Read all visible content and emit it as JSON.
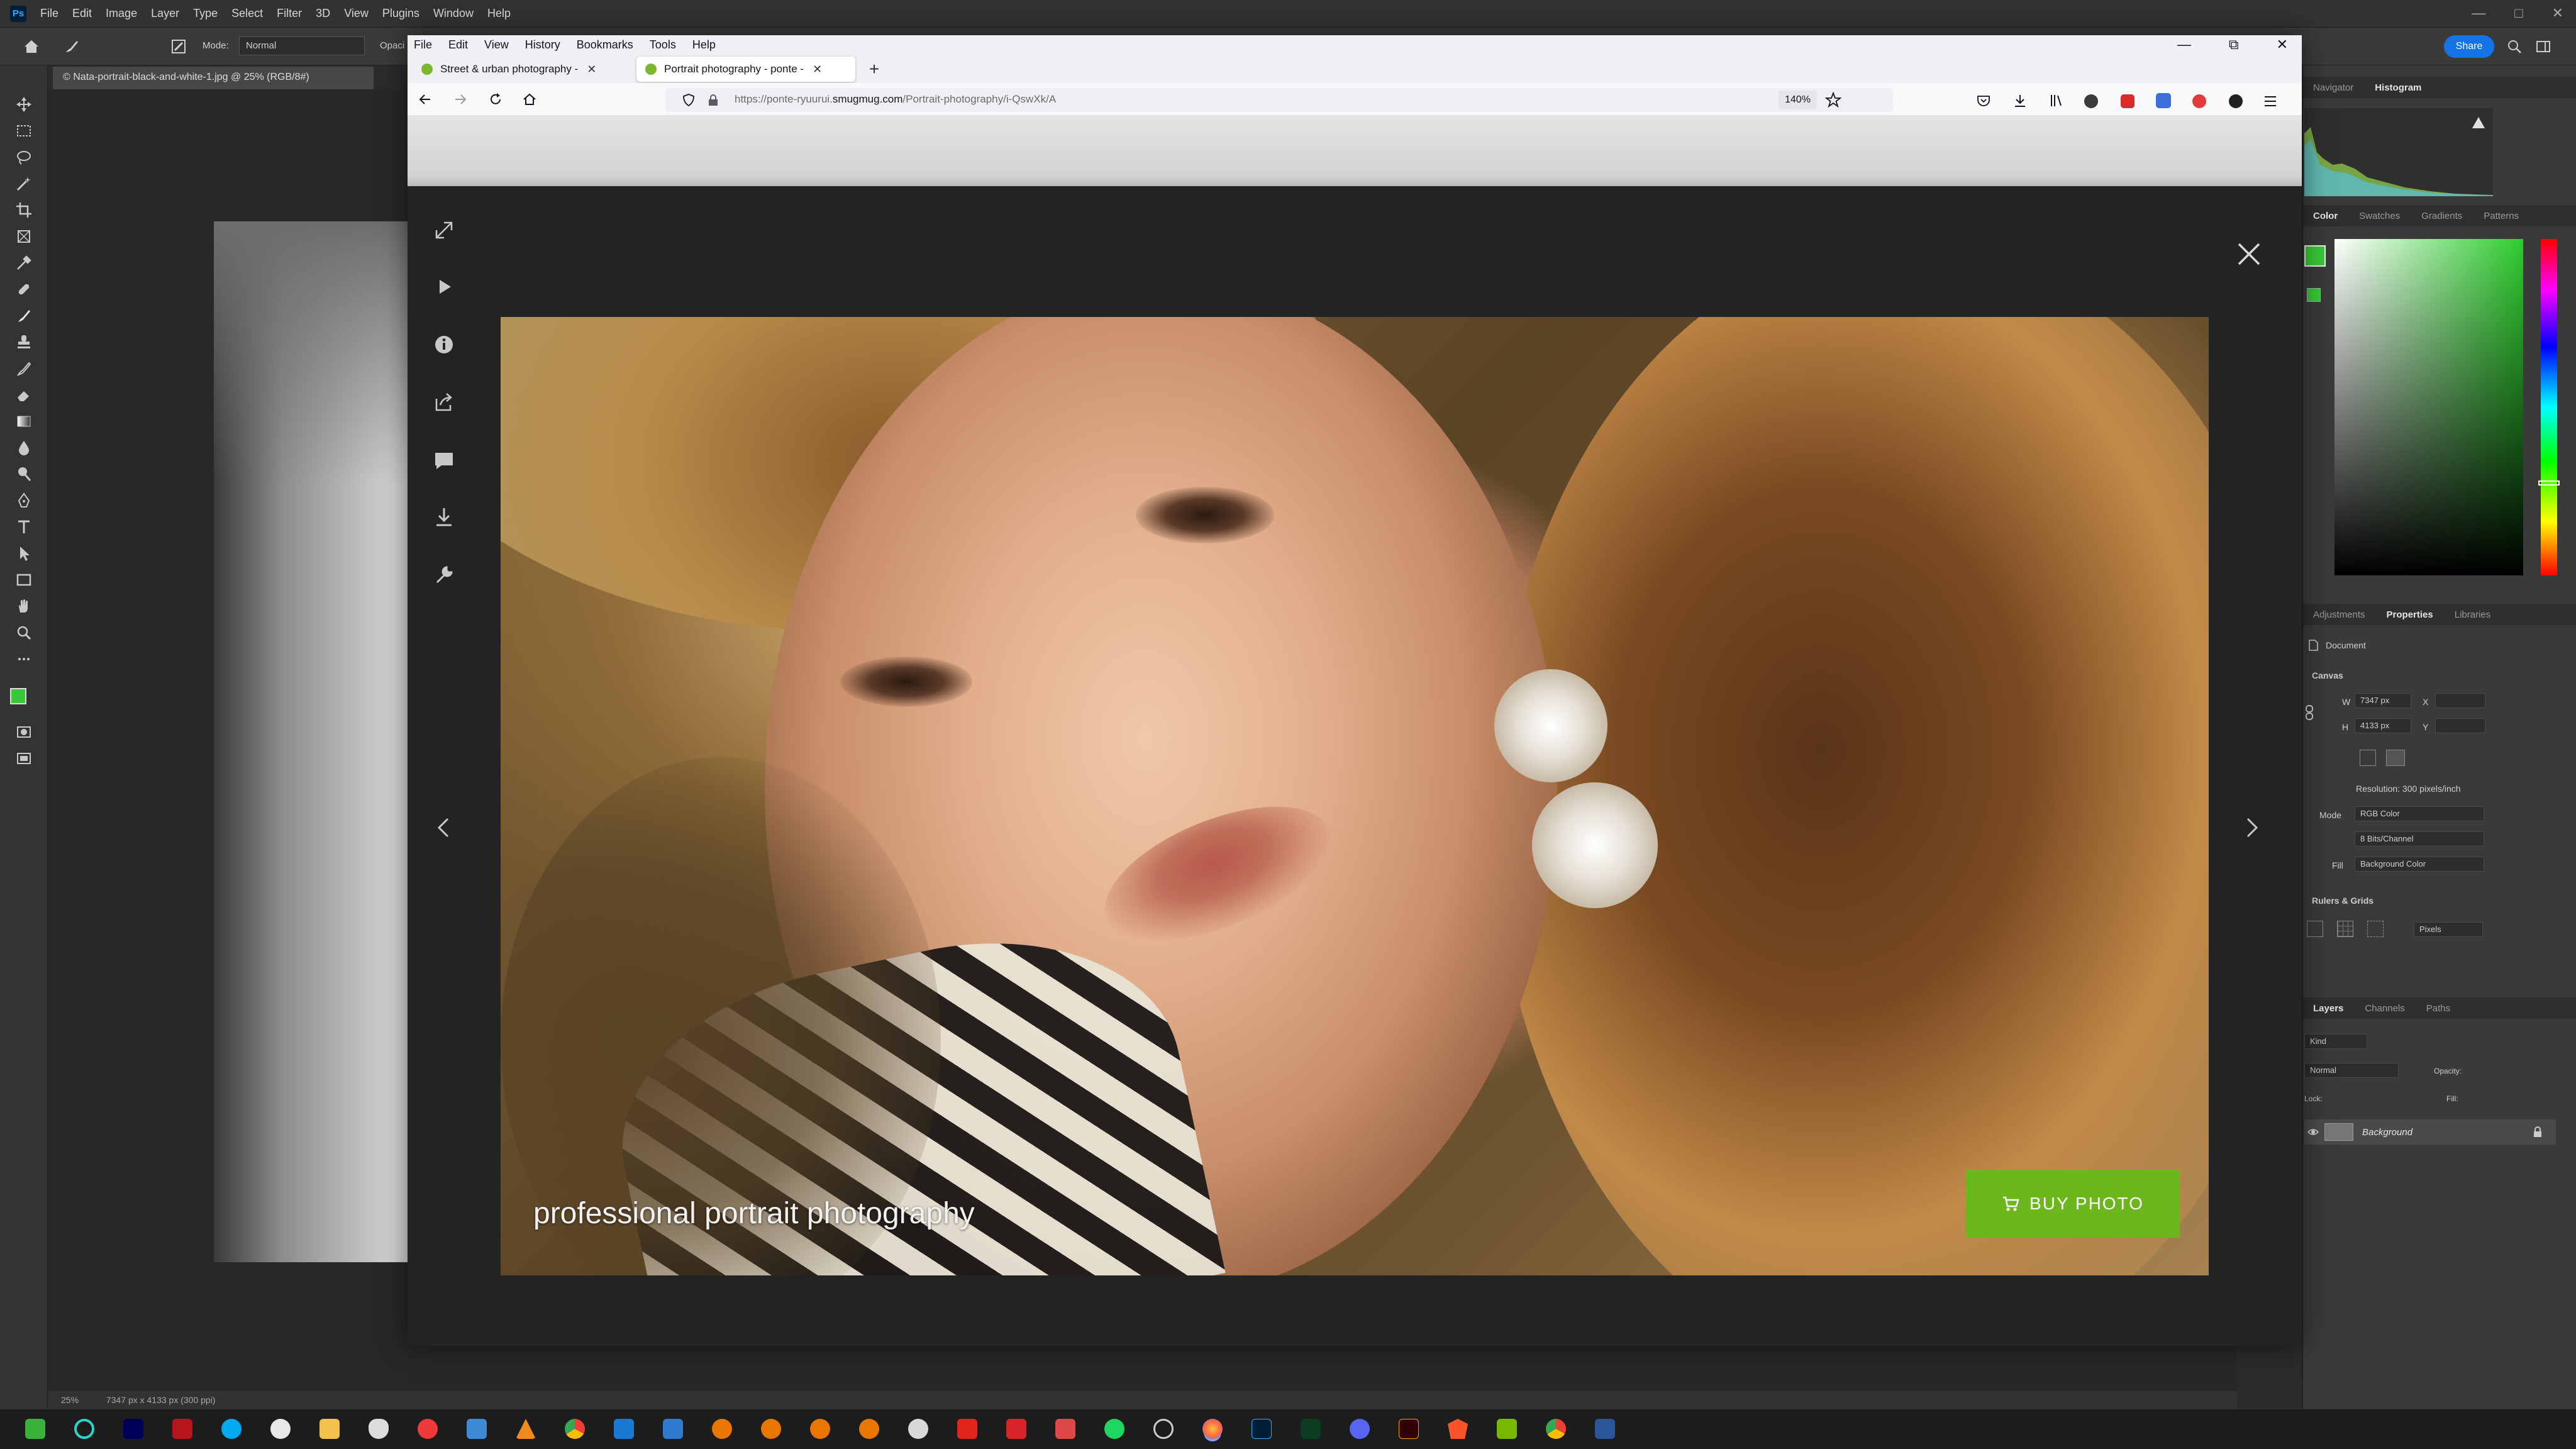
{
  "photoshop": {
    "logo_text": "Ps",
    "menu": [
      "File",
      "Edit",
      "Image",
      "Layer",
      "Type",
      "Select",
      "Filter",
      "3D",
      "View",
      "Plugins",
      "Window",
      "Help"
    ],
    "options_mode_label": "Mode:",
    "options_mode_value": "Normal",
    "options_opacity_label": "Opaci",
    "document_tab": "© Nata-portrait-black-and-white-1.jpg @ 25% (RGB/8#)",
    "share_label": "Share",
    "status_zoom": "25%",
    "status_info": "7347 px x 4133 px (300 ppi)",
    "panels": {
      "top_tabs": [
        "Navigator",
        "Histogram"
      ],
      "color_tabs": [
        "Color",
        "Swatches",
        "Gradients",
        "Patterns"
      ],
      "props_tabs": [
        "Adjustments",
        "Properties",
        "Libraries"
      ],
      "document_label": "Document",
      "canvas_label": "Canvas",
      "width_label": "W",
      "width_value": "7347 px",
      "height_label": "H",
      "height_value": "4133 px",
      "x_label": "X",
      "y_label": "Y",
      "resolution": "Resolution: 300 pixels/inch",
      "mode_label": "Mode",
      "mode_value": "RGB Color",
      "depth_value": "8 Bits/Channel",
      "fill_label": "Fill",
      "fill_value": "Background Color",
      "rulers_label": "Rulers & Grids",
      "units_value": "Pixels",
      "layer_tabs": [
        "Layers",
        "Channels",
        "Paths"
      ],
      "layer_kind": "Kind",
      "layer_blend": "Normal",
      "opacity_label": "Opacity:",
      "lock_label": "Lock:",
      "fill_short": "Fill:",
      "layer_name": "Background"
    },
    "colors": {
      "foreground": "#37c837",
      "accent": "#1473e6"
    }
  },
  "firefox": {
    "menu": [
      "File",
      "Edit",
      "View",
      "History",
      "Bookmarks",
      "Tools",
      "Help"
    ],
    "tabs": [
      {
        "title": "Street & urban photography -",
        "active": false
      },
      {
        "title": "Portrait photography - ponte -",
        "active": true
      }
    ],
    "url_prefix": "https://ponte-ryuurui.",
    "url_domain": "smugmug.com",
    "url_suffix": "/Portrait-photography/i-QswXk/A",
    "zoom": "140%",
    "lightbox": {
      "caption": "professional portrait photography",
      "buy_button": "BUY PHOTO",
      "sidebar_icons": [
        "expand-icon",
        "play-icon",
        "info-icon",
        "share-icon",
        "comment-icon",
        "download-icon",
        "wrench-icon"
      ],
      "accent_color": "#6cb61e"
    }
  },
  "taskbar": {
    "icons": [
      "start-icon",
      "browser-icon",
      "premiere-icon",
      "app-red-icon",
      "skype-icon",
      "obs-icon",
      "folder-icon",
      "app-icon",
      "vivaldi-icon",
      "app-icon",
      "vlc-icon",
      "chrome-icon",
      "mail-icon",
      "app-icon",
      "blender-icon",
      "blender-icon",
      "blender-icon",
      "blender-icon",
      "github-icon",
      "acrobat-icon",
      "app-red-icon",
      "app-red-icon",
      "spotify-icon",
      "settings-icon",
      "firefox-icon",
      "photoshop-icon",
      "pixel-icon",
      "discord-icon",
      "illustrator-icon",
      "brave-icon",
      "nvidia-icon",
      "chrome-icon",
      "word-icon"
    ]
  }
}
